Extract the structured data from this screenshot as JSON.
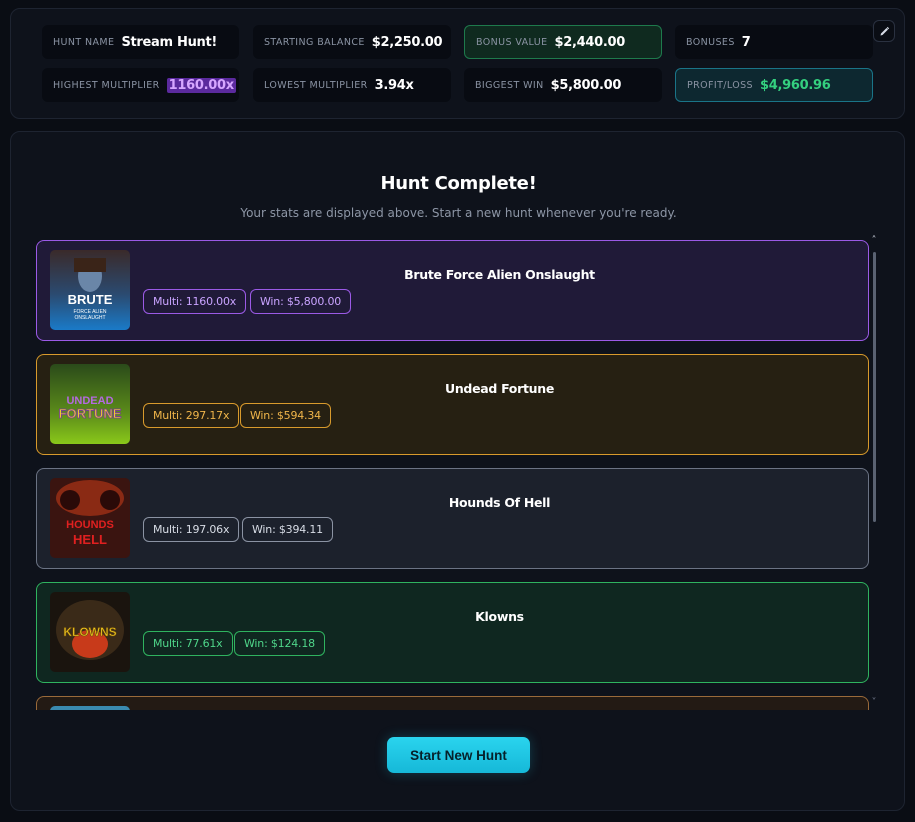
{
  "stats": {
    "hunt_name": {
      "label": "HUNT NAME",
      "value": "Stream Hunt!"
    },
    "starting_balance": {
      "label": "STARTING BALANCE",
      "value": "$2,250.00"
    },
    "bonus_value": {
      "label": "BONUS VALUE",
      "value": "$2,440.00"
    },
    "bonuses": {
      "label": "BONUSES",
      "value": "7"
    },
    "highest_multiplier": {
      "label": "HIGHEST MULTIPLIER",
      "value": "1160.00x"
    },
    "lowest_multiplier": {
      "label": "LOWEST MULTIPLIER",
      "value": "3.94x"
    },
    "biggest_win": {
      "label": "BIGGEST WIN",
      "value": "$5,800.00"
    },
    "profit_loss": {
      "label": "PROFIT/LOSS",
      "value": "$4,960.96"
    }
  },
  "edit_icon": "pencil-icon",
  "main": {
    "title": "Hunt Complete!",
    "subtitle": "Your stats are displayed above. Start a new hunt whenever you're ready."
  },
  "games": [
    {
      "name": "Brute Force Alien Onslaught",
      "multi": "Multi: 1160.00x",
      "win": "Win: $5,800.00",
      "color": "#9b5ae6",
      "thumb_text": "BRUTE"
    },
    {
      "name": "Undead Fortune",
      "multi": "Multi: 297.17x",
      "win": "Win: $594.34",
      "color": "#d89a2c",
      "thumb_text": "UNDEAD FORTUNE"
    },
    {
      "name": "Hounds Of Hell",
      "multi": "Multi: 197.06x",
      "win": "Win: $394.11",
      "color": "#6b7384",
      "thumb_text": "HOUNDS HELL"
    },
    {
      "name": "Klowns",
      "multi": "Multi: 77.61x",
      "win": "Win: $124.18",
      "color": "#2fb35f",
      "thumb_text": "KLOWNS"
    }
  ],
  "start_button": "Start New Hunt",
  "colors": {
    "accent": "#22c8e6",
    "profit": "#34d07f",
    "highest_multi_bg": "#5b2a9e"
  }
}
